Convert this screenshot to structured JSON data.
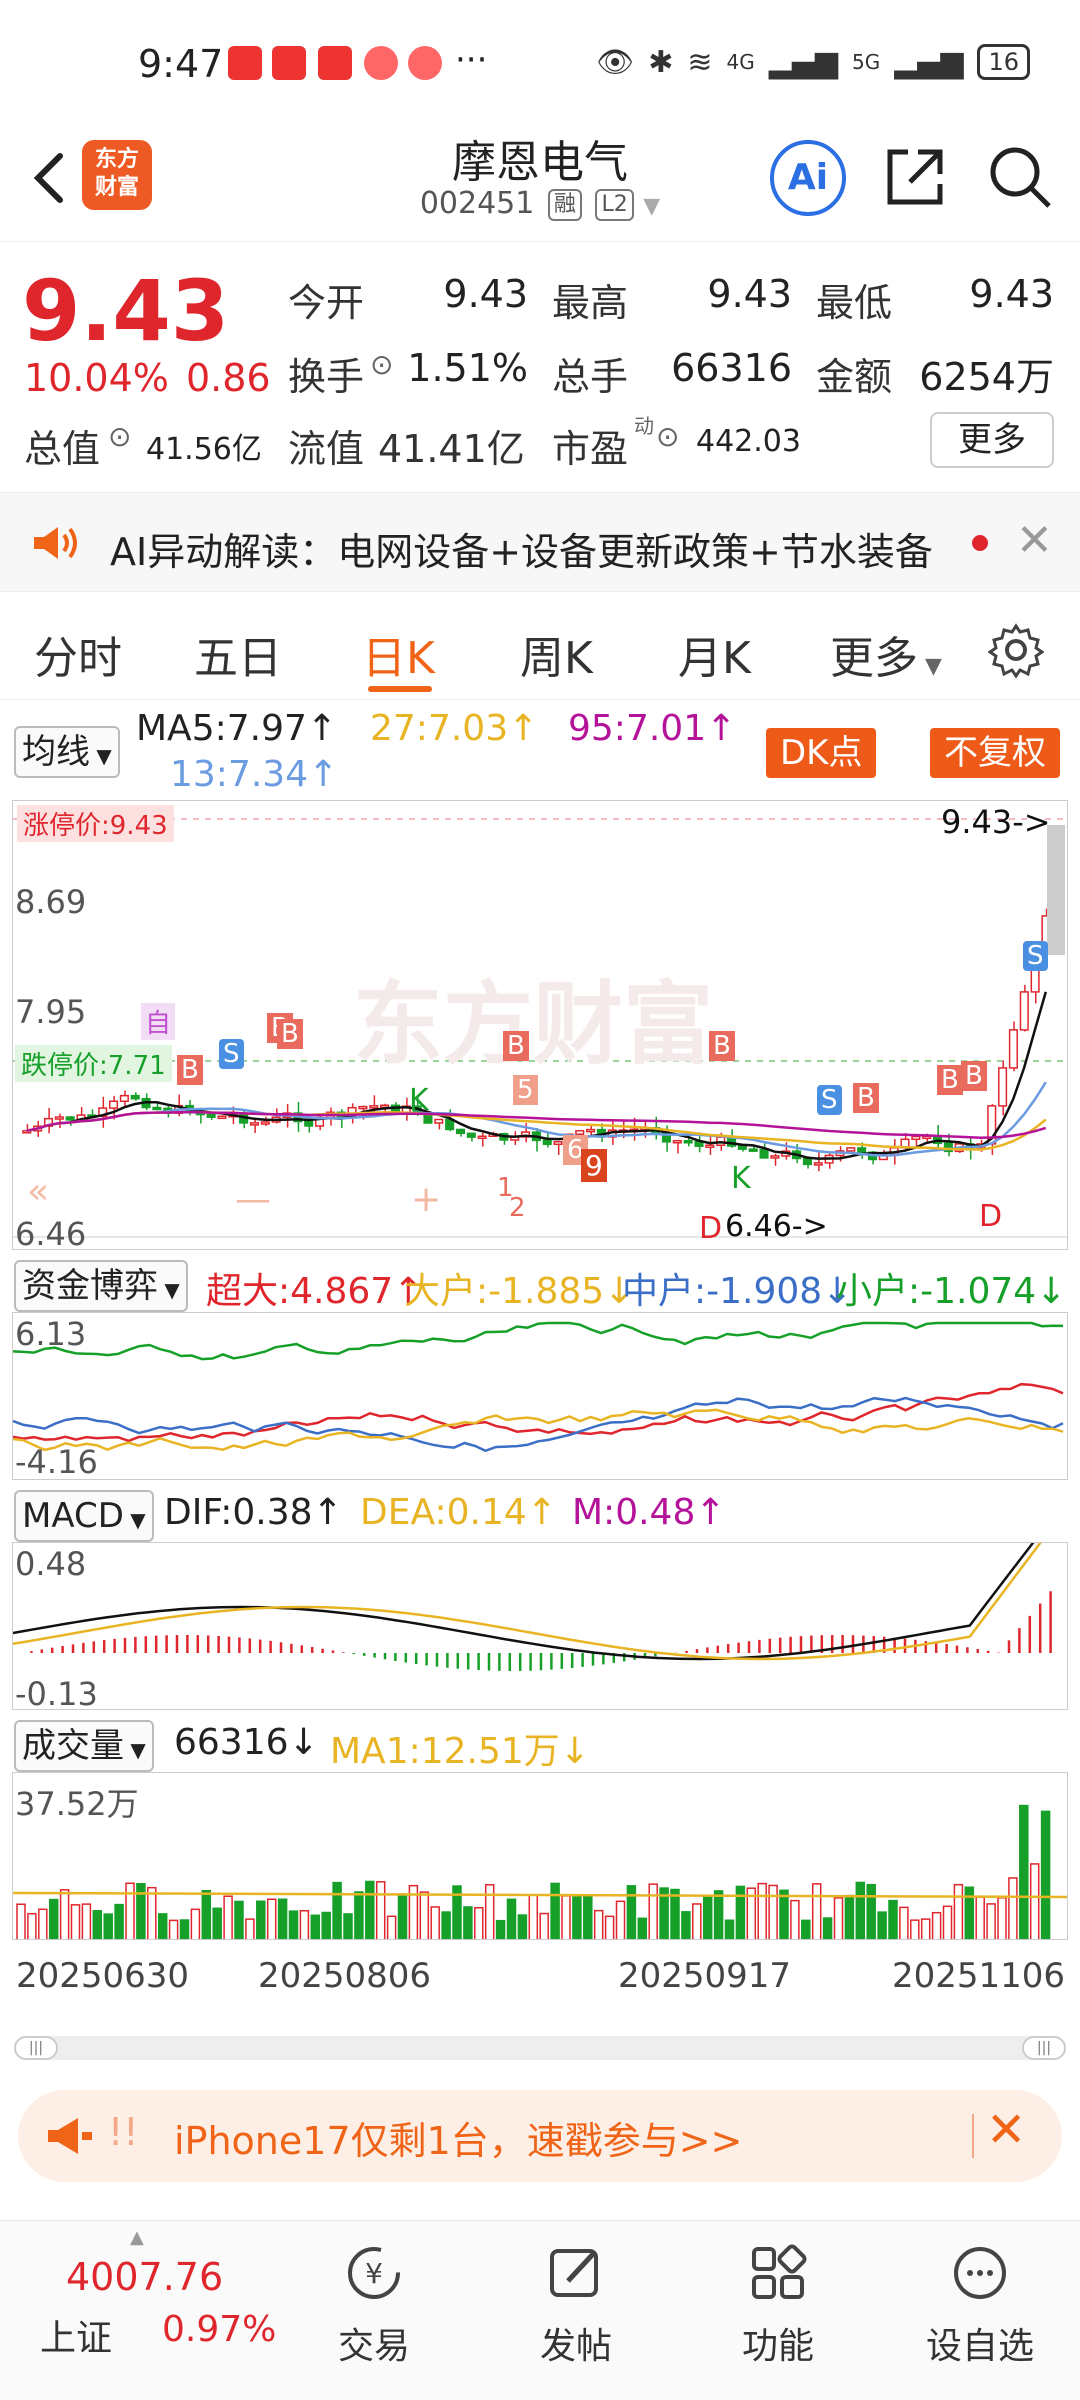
{
  "status_bar": {
    "time": "9:47",
    "more": "···",
    "signal_4g": "4G",
    "signal_5g": "5G",
    "battery": "16"
  },
  "header": {
    "logo_text": "东方\n财富",
    "title": "摩恩电气",
    "code": "002451",
    "tag_rong": "融",
    "tag_l2": "L2",
    "ai_label": "Ai"
  },
  "quote": {
    "price": "9.43",
    "pct": "10.04%",
    "change": "0.86",
    "open_label": "今开",
    "open": "9.43",
    "high_label": "最高",
    "high": "9.43",
    "low_label": "最低",
    "low": "9.43",
    "turnover_label": "换手",
    "turnover": "1.51%",
    "volume_label": "总手",
    "volume": "66316",
    "amount_label": "金额",
    "amount": "6254万",
    "mktcap_label": "总值",
    "mktcap": "41.56亿",
    "float_label": "流值",
    "float": "41.41亿",
    "pe_label": "市盈",
    "pe_sup": "动",
    "pe": "442.03",
    "more_button": "更多"
  },
  "ai_banner": {
    "text": "AI异动解读：电网设备+设备更新政策+节水装备"
  },
  "tabs": [
    "分时",
    "五日",
    "日K",
    "周K",
    "月K",
    "更多"
  ],
  "kline": {
    "ma_select": "均线",
    "ma5": "MA5:7.97↑",
    "ma13": "13:7.34↑",
    "ma27": "27:7.03↑",
    "ma95": "95:7.01↑",
    "dk_button": "DK点",
    "fq_button": "不复权",
    "limit_up": "涨停价:9.43",
    "limit_down": "跌停价:7.71",
    "price_now": "9.43->",
    "low_marker": "6.46->",
    "y_top": "8.69",
    "y_mid": "7.95",
    "y_low": "6.46",
    "watermark": "东方财富",
    "sig_zi": "自",
    "sig_b": "B",
    "sig_s": "S",
    "sig_k": "K",
    "sig_d": "D",
    "sig_9": "9",
    "sig_5": "5",
    "sig_6": "6",
    "sig_1": "1",
    "sig_2": "2",
    "sig_minus": "—",
    "sig_plus": "+",
    "sig_laquo": "«"
  },
  "fund_panel": {
    "select": "资金博弈",
    "super": "超大:4.867↑",
    "large": "大户:-1.885↓",
    "mid": "中户:-1.908↓",
    "small": "小户:-1.074↓",
    "y_top": "6.13",
    "y_bottom": "-4.16"
  },
  "macd_panel": {
    "select": "MACD",
    "dif": "DIF:0.38↑",
    "dea": "DEA:0.14↑",
    "m": "M:0.48↑",
    "y_top": "0.48",
    "y_bottom": "-0.13"
  },
  "volume_panel": {
    "select": "成交量",
    "vol": "66316↓",
    "ma1": "MA1:12.51万↓",
    "y_top": "37.52万"
  },
  "dates": [
    "20250630",
    "20250806",
    "20250917",
    "20251106"
  ],
  "promo": {
    "text": "iPhone17仅剩1台，速戳参与>>",
    "prefix": "!!"
  },
  "bottom_nav": {
    "index_value": "4007.76",
    "index_name": "上证",
    "index_pct": "0.97%",
    "items": [
      "交易",
      "发帖",
      "功能",
      "设自选"
    ]
  },
  "colors": {
    "up": "#e0262d",
    "down": "#16a029",
    "accent": "#f06418"
  }
}
